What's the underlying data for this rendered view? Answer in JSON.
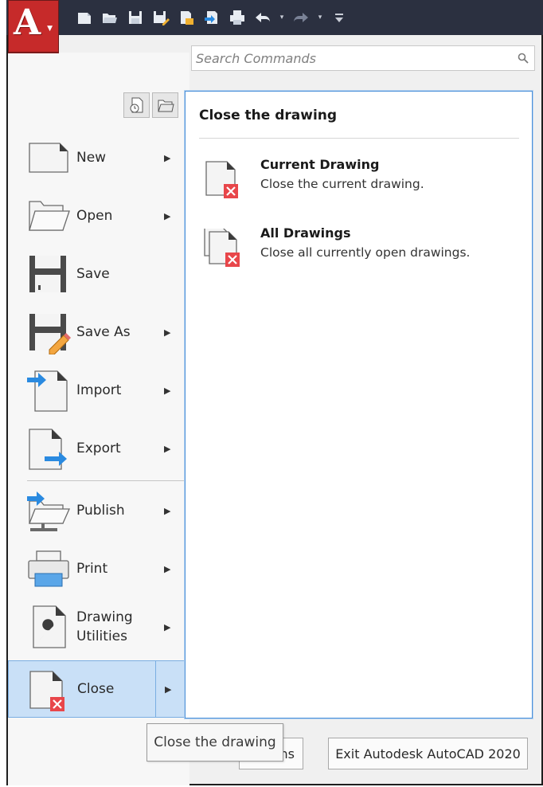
{
  "app": {
    "letter": "A",
    "accent": "#c62a2a"
  },
  "quick_access": {
    "icons": [
      "new-icon",
      "open-icon",
      "save-icon",
      "save-as-icon",
      "open-from-web-icon",
      "save-to-web-icon",
      "plot-icon",
      "undo-icon",
      "redo-icon",
      "customize-icon"
    ]
  },
  "search": {
    "placeholder": "Search Commands"
  },
  "menu": {
    "items": [
      {
        "label": "New",
        "has_submenu": true
      },
      {
        "label": "Open",
        "has_submenu": true
      },
      {
        "label": "Save",
        "has_submenu": false
      },
      {
        "label": "Save As",
        "has_submenu": true
      },
      {
        "label": "Import",
        "has_submenu": true
      },
      {
        "label": "Export",
        "has_submenu": true
      },
      {
        "label": "Publish",
        "has_submenu": true
      },
      {
        "label": "Print",
        "has_submenu": true
      },
      {
        "label": "Drawing Utilities",
        "has_submenu": true
      },
      {
        "label": "Close",
        "has_submenu": true,
        "active": true
      }
    ]
  },
  "panel": {
    "title": "Close the drawing",
    "options": [
      {
        "title": "Current Drawing",
        "description": "Close the current drawing."
      },
      {
        "title": "All Drawings",
        "description": "Close all currently open drawings."
      }
    ]
  },
  "footer": {
    "options_label": "ns",
    "exit_label": "Exit Autodesk AutoCAD 2020"
  },
  "tooltip": {
    "text": "Close the drawing"
  },
  "colors": {
    "title_bar": "#2b3040",
    "active_item": "#c9e0f7",
    "panel_border": "#4a90d9",
    "close_badge": "#e8464a",
    "arrow_blue": "#2a8ae0"
  }
}
